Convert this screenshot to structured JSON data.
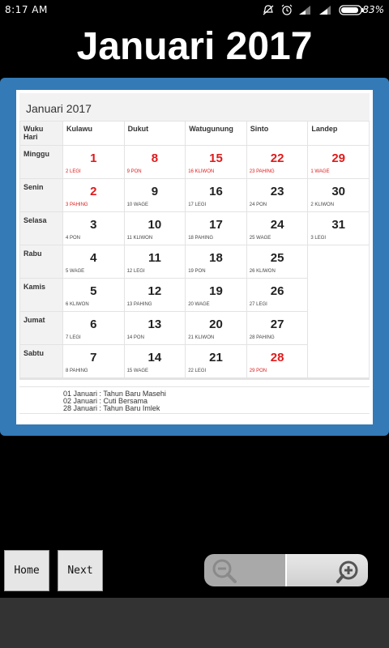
{
  "status_bar": {
    "time": "8:17 AM",
    "battery_percent": "83%",
    "icons": [
      "mute-icon",
      "alarm-icon",
      "signal-icon",
      "signal-icon",
      "battery-icon"
    ]
  },
  "title": "Januari 2017",
  "calendar": {
    "title": "Januari 2017",
    "corner_label": [
      "Wuku",
      "Hari"
    ],
    "columns": [
      "Kulawu",
      "Dukut",
      "Watugunung",
      "Sinto",
      "Landep"
    ],
    "days": [
      "Minggu",
      "Senin",
      "Selasa",
      "Rabu",
      "Kamis",
      "Jumat",
      "Sabtu"
    ],
    "rows": [
      [
        {
          "n": "1",
          "p": "2 LEGI",
          "red": true
        },
        {
          "n": "8",
          "p": "9 PON",
          "red": true
        },
        {
          "n": "15",
          "p": "16 KLIWON",
          "red": true
        },
        {
          "n": "22",
          "p": "23 PAHING",
          "red": true
        },
        {
          "n": "29",
          "p": "1 WAGE",
          "red": true
        }
      ],
      [
        {
          "n": "2",
          "p": "3 PAHING",
          "red": true
        },
        {
          "n": "9",
          "p": "10 WAGE"
        },
        {
          "n": "16",
          "p": "17 LEGI"
        },
        {
          "n": "23",
          "p": "24 PON"
        },
        {
          "n": "30",
          "p": "2 KLIWON"
        }
      ],
      [
        {
          "n": "3",
          "p": "4 PON"
        },
        {
          "n": "10",
          "p": "11 KLIWON"
        },
        {
          "n": "17",
          "p": "18 PAHING"
        },
        {
          "n": "24",
          "p": "25 WAGE"
        },
        {
          "n": "31",
          "p": "3 LEGI"
        }
      ],
      [
        {
          "n": "4",
          "p": "5 WAGE"
        },
        {
          "n": "11",
          "p": "12 LEGI"
        },
        {
          "n": "18",
          "p": "19 PON"
        },
        {
          "n": "25",
          "p": "26 KLIWON"
        },
        {
          "n": "",
          "p": ""
        }
      ],
      [
        {
          "n": "5",
          "p": "6 KLIWON"
        },
        {
          "n": "12",
          "p": "13 PAHING"
        },
        {
          "n": "19",
          "p": "20 WAGE"
        },
        {
          "n": "26",
          "p": "27 LEGI"
        },
        {
          "n": "",
          "p": ""
        }
      ],
      [
        {
          "n": "6",
          "p": "7 LEGI"
        },
        {
          "n": "13",
          "p": "14 PON"
        },
        {
          "n": "20",
          "p": "21 KLIWON"
        },
        {
          "n": "27",
          "p": "28 PAHING"
        },
        {
          "n": "",
          "p": ""
        }
      ],
      [
        {
          "n": "7",
          "p": "8 PAHING"
        },
        {
          "n": "14",
          "p": "15 WAGE"
        },
        {
          "n": "21",
          "p": "22 LEGI"
        },
        {
          "n": "28",
          "p": "29 PON",
          "red": true
        },
        {
          "n": "",
          "p": ""
        }
      ]
    ]
  },
  "holidays": [
    "01 Januari : Tahun Baru Masehi",
    "02 Januari : Cuti Bersama",
    "28 Januari : Tahun Baru Imlek"
  ],
  "buttons": {
    "home": "Home",
    "next": "Next"
  },
  "zoom": {
    "out_icon": "zoom-out-icon",
    "in_icon": "zoom-in-icon"
  },
  "colors": {
    "frame": "#337ab7",
    "holiday_red": "#e01a1a",
    "background": "#000000"
  }
}
